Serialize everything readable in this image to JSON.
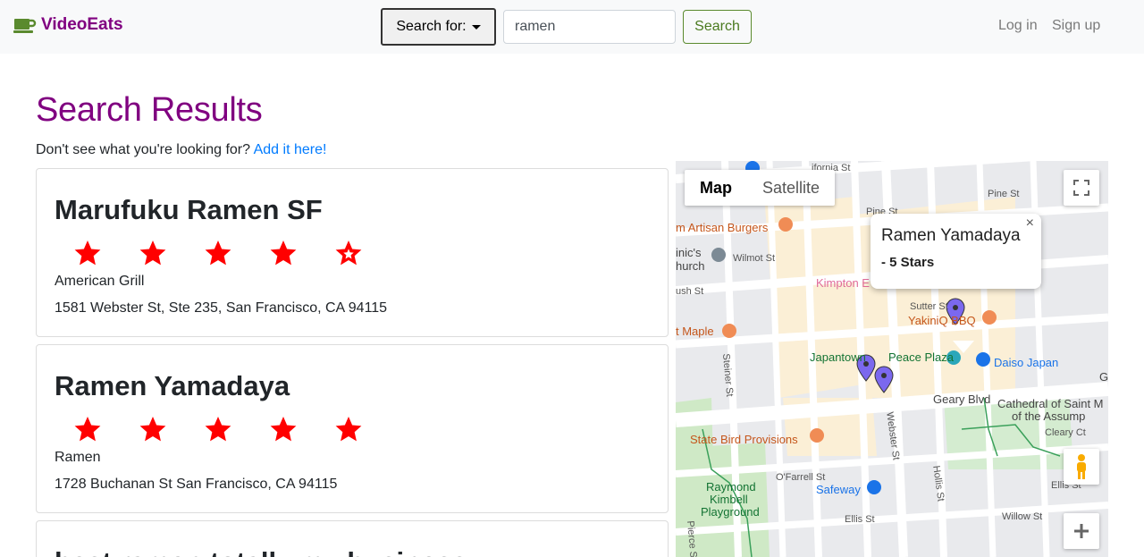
{
  "navbar": {
    "brand": "VideoEats",
    "search_type_label": "Search for:",
    "search_value": "ramen",
    "search_button": "Search",
    "login": "Log in",
    "signup": "Sign up"
  },
  "page": {
    "title": "Search Results",
    "hint_text": "Don't see what you're looking for?",
    "hint_link": "Add it here!"
  },
  "results": [
    {
      "name": "Marufuku Ramen SF",
      "rating": 4.5,
      "category": "American Grill",
      "address": "1581 Webster St, Ste 235, San Francisco, CA 94115"
    },
    {
      "name": "Ramen Yamadaya",
      "rating": 5,
      "category": "Ramen",
      "address": "1728 Buchanan St San Francisco, CA 94115"
    },
    {
      "name": "best ramen totally my business"
    }
  ],
  "map": {
    "type_map": "Map",
    "type_satellite": "Satellite",
    "infowindow_title": "Ramen Yamadaya",
    "infowindow_rating": "- 5 Stars",
    "infowindow_close": "×",
    "labels": {
      "california_st": "ifornia St",
      "pine_st": "Pine St",
      "pine_st_2": "Pine St",
      "artisan_burgers": "m Artisan Burgers",
      "church_1": "inic's",
      "church_2": "hurch",
      "wilmot_st": "Wilmot St",
      "bush_st": "ush St",
      "kimpton": "Kimpton E",
      "sutter_st": "Sutter St",
      "yakiniq": "YakiniQ BBQ",
      "maple": "t Maple",
      "steiner_st": "Steiner St",
      "japantown": "Japantown",
      "peace_plaza": "Peace Plaza",
      "daiso": "Daiso Japan",
      "geary_blvd": "Geary Blvd",
      "cathedral_1": "Cathedral of Saint M",
      "cathedral_2": "of the Assump",
      "state_bird": "State Bird Provisions",
      "webster_st": "Webster St",
      "cleary_ct": "Cleary Ct",
      "hollis_st": "Hollis St",
      "ofarrell_st": "O'Farrell St",
      "raymond_1": "Raymond",
      "raymond_2": "Kimbell",
      "raymond_3": "Playground",
      "safeway": "Safeway",
      "ellis_st": "Ellis St",
      "ellis_st_2": "Ellis St",
      "willow_st": "Willow St",
      "pierce_st": "Pierce St",
      "g_cut": "G"
    }
  },
  "colors": {
    "brand": "#800080",
    "title": "#800080",
    "star": "#ff0000",
    "link": "#007bff",
    "marker": "#7b68ee"
  }
}
